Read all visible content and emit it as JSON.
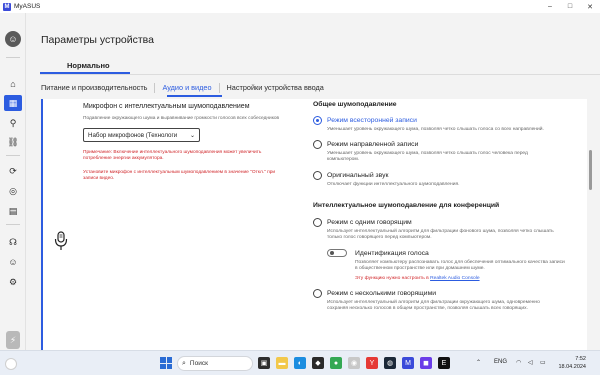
{
  "app": {
    "title": "MyASUS",
    "logo_text": "M",
    "window_controls": [
      "–",
      "□",
      "✕"
    ]
  },
  "rail": {
    "items": [
      {
        "name": "home-icon",
        "glyph": "⌂"
      },
      {
        "name": "device-settings-icon",
        "glyph": "▦",
        "active": true
      },
      {
        "name": "wrench-icon",
        "glyph": "⚲"
      },
      {
        "name": "link-icon",
        "glyph": "⛓"
      },
      {
        "name": "update-icon",
        "glyph": "⟳"
      },
      {
        "name": "recommendations-icon",
        "glyph": "◎"
      },
      {
        "name": "news-icon",
        "glyph": "▤"
      },
      {
        "name": "support-icon",
        "glyph": "☊"
      },
      {
        "name": "user-icon",
        "glyph": "☺"
      },
      {
        "name": "settings-icon",
        "glyph": "⚙"
      }
    ]
  },
  "page": {
    "title": "Параметры устройства",
    "mode_tab": "Нормально",
    "subtabs": [
      "Питание и производительность",
      "Аудио и видео",
      "Настройки устройства ввода"
    ]
  },
  "microphone": {
    "title": "Микрофон с интеллектуальным шумоподавлением",
    "description": "Подавление окружающего шума и выравнивание громкости голосов всех собеседников",
    "select_value": "Набор микрофонов (Технологи",
    "warning1": "Примечание: Включение интеллектуального шумоподавления может увеличить потребление энергии аккумулятора.",
    "warning2": "Установите микрофон с интеллектуальным шумоподавлением в значение \"Откл.\" при записи видео."
  },
  "noise": {
    "general_title": "Общее шумоподавление",
    "options": [
      {
        "label": "Режим всесторонней записи",
        "desc": "Уменьшает уровень окружающего шума, позволяя четко слышать голоса со всех направлений.",
        "selected": true
      },
      {
        "label": "Режим направленной записи",
        "desc": "Уменьшает уровень окружающего шума, позволяя четко слышать голос человека перед компьютером.",
        "selected": false
      },
      {
        "label": "Оригинальный звук",
        "desc": "Отключает функции интеллектуального шумоподавления.",
        "selected": false
      }
    ],
    "conf_title": "Интеллектуальное шумоподавление для конференций",
    "single": {
      "label": "Режим с одним говорящим",
      "desc": "Использует интеллектуальный алгоритм для фильтрации фонового шума, позволяя четко слышать только голос говорящего перед компьютером."
    },
    "voice_id": {
      "label": "Идентификация голоса",
      "desc": "Позволяет компьютеру распознавать голос для обеспечения оптимального качества записи в общественном пространстве или при домашнем шуме.",
      "link_prefix": "Эту функцию нужно настроить в",
      "link_text": "Realtek Audio Console"
    },
    "multi": {
      "label": "Режим с несколькими говорящими",
      "desc": "Использует интеллектуальный алгоритм для фильтрации окружающего шума, одновременно сохраняя несколько голосов в общем пространстве, позволяя слышать всех говорящих."
    }
  },
  "taskbar": {
    "search_placeholder": "Поиск",
    "language": "ENG",
    "time": "7:52",
    "date": "18.04.2024"
  },
  "colors": {
    "accent": "#2c5ce0",
    "warning": "#d0262a"
  }
}
